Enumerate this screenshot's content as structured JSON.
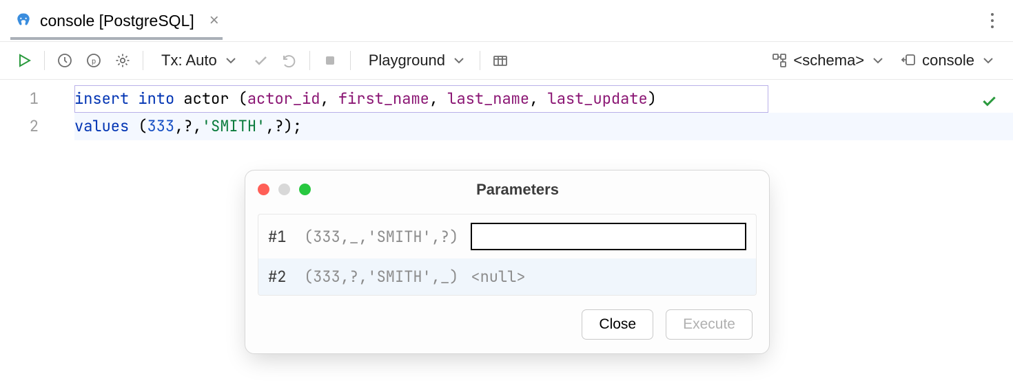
{
  "tab": {
    "title": "console [PostgreSQL]"
  },
  "toolbar": {
    "tx_label": "Tx: Auto",
    "playground_label": "Playground",
    "schema_label": "<schema>",
    "console_label": "console"
  },
  "gutter": {
    "lines": [
      "1",
      "2"
    ]
  },
  "code": {
    "line1": {
      "kw_insert": "insert",
      "kw_into": "into",
      "id_table": "actor",
      "open": "(",
      "cols": {
        "c1": "actor_id",
        "c2": "first_name",
        "c3": "last_name",
        "c4": "last_update"
      },
      "close": ")",
      "comma": ", "
    },
    "line2": {
      "kw_values": "values",
      "open": "(",
      "v_num": "333",
      "comma": ",",
      "v_q1": "?",
      "v_str": "'SMITH'",
      "v_q2": "?",
      "close": ")",
      "semi": ";"
    }
  },
  "dialog": {
    "title": "Parameters",
    "rows": [
      {
        "idx": "#1",
        "context": "(333,_,'SMITH',?)",
        "value": "",
        "active": true
      },
      {
        "idx": "#2",
        "context": "(333,?,'SMITH',_)",
        "null_text": "<null>",
        "active": false
      }
    ],
    "close_btn": "Close",
    "execute_btn": "Execute"
  }
}
